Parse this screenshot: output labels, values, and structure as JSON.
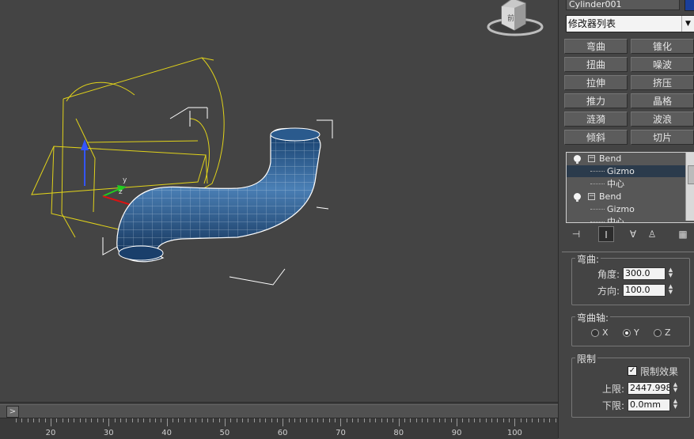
{
  "panel": {
    "object_name": "Cylinder001",
    "object_color": "#1a3f9a",
    "modifier_list": "修改器列表",
    "modifier_buttons": [
      "弯曲",
      "锥化",
      "扭曲",
      "噪波",
      "拉伸",
      "挤压",
      "推力",
      "晶格",
      "涟漪",
      "波浪",
      "倾斜",
      "切片"
    ],
    "stack": [
      {
        "label": "Bend",
        "type": "modifier"
      },
      {
        "label": "Gizmo",
        "type": "sub",
        "selected": true
      },
      {
        "label": "中心",
        "type": "sub"
      },
      {
        "label": "Bend",
        "type": "modifier"
      },
      {
        "label": "Gizmo",
        "type": "sub"
      },
      {
        "label": "中心",
        "type": "sub"
      }
    ],
    "toolbar_icons": [
      "pin-stack-icon",
      "show-end-result-icon",
      "make-unique-icon",
      "remove-modifier-icon",
      "configure-sets-icon"
    ]
  },
  "params": {
    "bend_group_title": "弯曲:",
    "angle_label": "角度:",
    "angle_value": "300.0",
    "direction_label": "方向:",
    "direction_value": "100.0",
    "axis_group_title": "弯曲轴:",
    "axes": [
      "X",
      "Y",
      "Z"
    ],
    "axis_selected": "Y",
    "limit_group_title": "限制",
    "limit_effect_label": "限制效果",
    "limit_effect_checked": true,
    "upper_label": "上限:",
    "upper_value": "2447.998",
    "lower_label": "下限:",
    "lower_value": "0.0mm"
  },
  "viewport": {
    "viewcube_label": "前",
    "colors": {
      "background": "#444444",
      "gizmo": "#e0d21a",
      "tube": "#1f4d7e",
      "bbox": "#ffffff"
    }
  },
  "timeline": {
    "arrow": ">",
    "ticks": [
      "20",
      "30",
      "40",
      "50",
      "60",
      "70",
      "80",
      "90",
      "100"
    ]
  }
}
